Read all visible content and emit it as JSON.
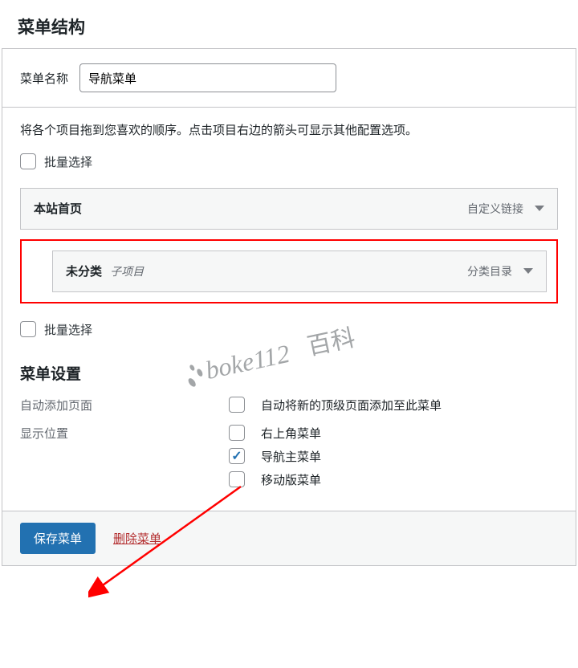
{
  "page_title": "菜单结构",
  "menu_name": {
    "label": "菜单名称",
    "value": "导航菜单"
  },
  "instructions": "将各个项目拖到您喜欢的顺序。点击项目右边的箭头可显示其他配置选项。",
  "bulk_select_label": "批量选择",
  "menu_items": [
    {
      "title": "本站首页",
      "sub": "",
      "type": "自定义链接"
    },
    {
      "title": "未分类",
      "sub": "子项目",
      "type": "分类目录"
    }
  ],
  "menu_settings_title": "菜单设置",
  "auto_add": {
    "label": "自动添加页面",
    "option": "自动将新的顶级页面添加至此菜单",
    "checked": false
  },
  "display_location": {
    "label": "显示位置",
    "options": [
      {
        "label": "右上角菜单",
        "checked": false
      },
      {
        "label": "导航主菜单",
        "checked": true
      },
      {
        "label": "移动版菜单",
        "checked": false
      }
    ]
  },
  "save_button": "保存菜单",
  "delete_link": "删除菜单",
  "watermark": "boke112百科"
}
